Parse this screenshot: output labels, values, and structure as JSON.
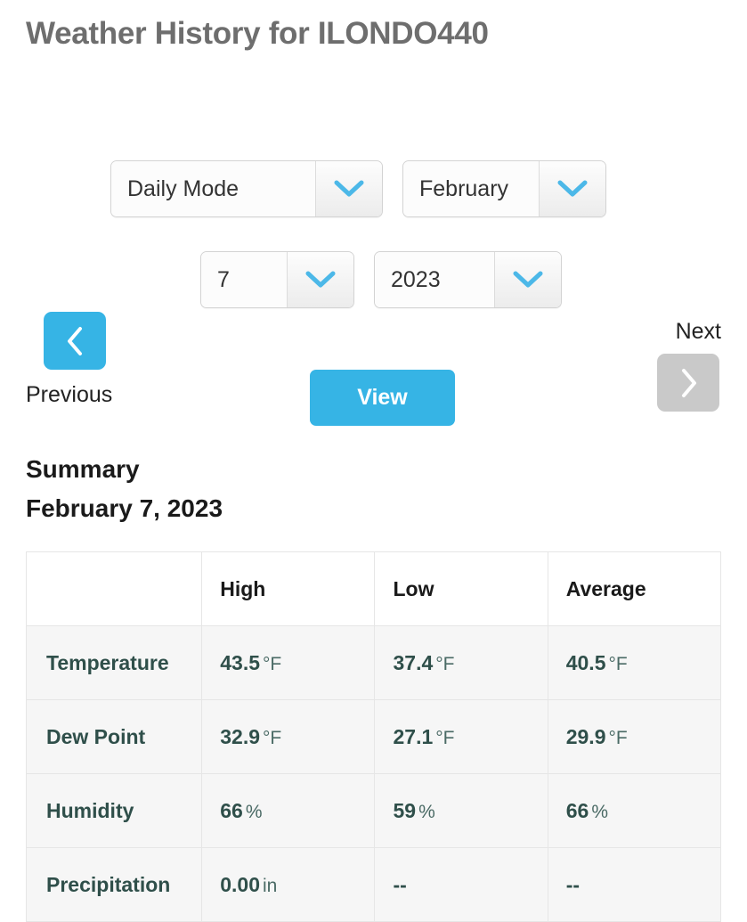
{
  "page": {
    "title": "Weather History for ILONDO440"
  },
  "colors": {
    "accent_blue": "#36b4e5",
    "disabled_grey": "#c9c9c9",
    "title_grey": "#6e6e6e",
    "table_text": "#2f4f4a",
    "row_background": "#f6f6f6"
  },
  "selectors": {
    "mode": {
      "label": "Daily Mode",
      "icon": "chevron-down-icon"
    },
    "month": {
      "label": "February",
      "icon": "chevron-down-icon"
    },
    "day": {
      "label": "7",
      "icon": "chevron-down-icon"
    },
    "year": {
      "label": "2023",
      "icon": "chevron-down-icon"
    }
  },
  "navigation": {
    "previous_label": "Previous",
    "next_label": "Next",
    "previous_icon": "chevron-left-icon",
    "next_icon": "chevron-right-icon",
    "view_label": "View"
  },
  "summary": {
    "heading": "Summary",
    "date": "February 7, 2023",
    "columns": [
      "",
      "High",
      "Low",
      "Average"
    ],
    "rows": [
      {
        "label": "Temperature",
        "high": {
          "value": "43.5",
          "unit": "°F"
        },
        "low": {
          "value": "37.4",
          "unit": "°F"
        },
        "average": {
          "value": "40.5",
          "unit": "°F"
        }
      },
      {
        "label": "Dew Point",
        "high": {
          "value": "32.9",
          "unit": "°F"
        },
        "low": {
          "value": "27.1",
          "unit": "°F"
        },
        "average": {
          "value": "29.9",
          "unit": "°F"
        }
      },
      {
        "label": "Humidity",
        "high": {
          "value": "66",
          "unit": "%"
        },
        "low": {
          "value": "59",
          "unit": "%"
        },
        "average": {
          "value": "66",
          "unit": "%"
        }
      },
      {
        "label": "Precipitation",
        "high": {
          "value": "0.00",
          "unit": "in"
        },
        "low": {
          "value": "--",
          "unit": ""
        },
        "average": {
          "value": "--",
          "unit": ""
        }
      }
    ]
  }
}
